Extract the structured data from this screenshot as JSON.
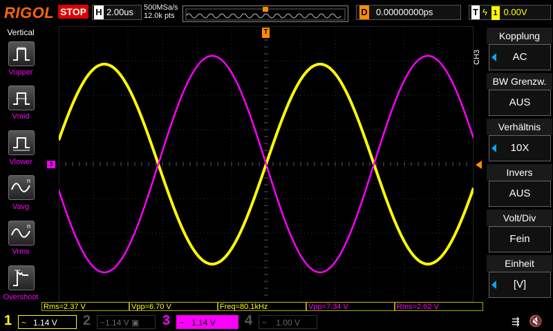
{
  "topbar": {
    "logo": "RIGOL",
    "run_state": "STOP",
    "horizontal_label": "H",
    "timebase": "2.00us",
    "sample_rate": "500MSa/s",
    "points": "12.0k pts",
    "delay_label": "D",
    "delay": "0.00000000ps",
    "trigger_label": "T",
    "trigger_channel": "1",
    "trigger_level": "0.00V"
  },
  "left_panel": {
    "title": "Vertical",
    "items": [
      {
        "label": "Vupper",
        "icon": "vupper-icon"
      },
      {
        "label": "Vmid",
        "icon": "vmid-icon"
      },
      {
        "label": "Vlower",
        "icon": "vlower-icon"
      },
      {
        "label": "Vavg",
        "icon": "vavg-icon"
      },
      {
        "label": "Vrms",
        "icon": "vrms-icon"
      },
      {
        "label": "Overshoot",
        "icon": "overshoot-icon"
      }
    ]
  },
  "right_panel": {
    "channel_tag": "CH3",
    "items": [
      {
        "heading": "Kopplung",
        "value": "AC",
        "arrow": true
      },
      {
        "heading": "BW Grenzw.",
        "value": "AUS",
        "arrow": false
      },
      {
        "heading": "Verhältnis",
        "value": "10X",
        "arrow": true
      },
      {
        "heading": "Invers",
        "value": "AUS",
        "arrow": false
      },
      {
        "heading": "Volt/Div",
        "value": "Fein",
        "arrow": false
      },
      {
        "heading": "Einheit",
        "value": "[V]",
        "arrow": true
      }
    ]
  },
  "measurements": [
    {
      "text": "Rms=2.37 V",
      "color": "#ffff00"
    },
    {
      "text": "Vpp=6.70 V",
      "color": "#ffff00"
    },
    {
      "text": "Freq=80.1kHz",
      "color": "#ffff00"
    },
    {
      "text": "Vpp=7.34 V",
      "color": "#ff00ff"
    },
    {
      "text": "Rms=2.62 V",
      "color": "#ff00ff"
    }
  ],
  "channels": [
    {
      "num": "1",
      "coupling": "~",
      "scale": "1.14 V",
      "color": "#ffff00",
      "active": true
    },
    {
      "num": "2",
      "coupling": "~",
      "scale": "1.14 V",
      "color": "#555555",
      "active": false
    },
    {
      "num": "3",
      "coupling": "~",
      "scale": "1.14 V",
      "color": "#ff00ff",
      "active": true
    },
    {
      "num": "4",
      "coupling": "~",
      "scale": "1.00 V",
      "color": "#555555",
      "active": false
    }
  ],
  "markers": {
    "trigger_position": "T",
    "ch3_offset": "3"
  },
  "colors": {
    "ch1": "#ffff00",
    "ch3": "#ff00ff",
    "trigger": "#ff8c00",
    "accent": "#00aaff"
  }
}
